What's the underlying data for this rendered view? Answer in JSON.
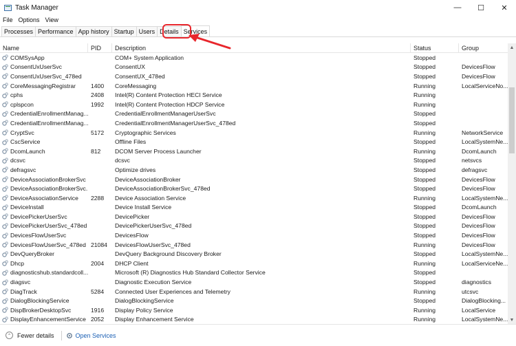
{
  "window": {
    "title": "Task Manager",
    "controls": [
      "—",
      "☐",
      "✕"
    ]
  },
  "menu": [
    "File",
    "Options",
    "View"
  ],
  "tabs": [
    {
      "label": "Processes",
      "active": false
    },
    {
      "label": "Performance",
      "active": false
    },
    {
      "label": "App history",
      "active": false
    },
    {
      "label": "Startup",
      "active": false
    },
    {
      "label": "Users",
      "active": false
    },
    {
      "label": "Details",
      "active": false
    },
    {
      "label": "Services",
      "active": true
    }
  ],
  "columns": [
    "Name",
    "PID",
    "Description",
    "Status",
    "Group"
  ],
  "services": [
    [
      "COMSysApp",
      "",
      "COM+ System Application",
      "Stopped",
      ""
    ],
    [
      "ConsentUxUserSvc",
      "",
      "ConsentUX",
      "Stopped",
      "DevicesFlow"
    ],
    [
      "ConsentUxUserSvc_478ed",
      "",
      "ConsentUX_478ed",
      "Stopped",
      "DevicesFlow"
    ],
    [
      "CoreMessagingRegistrar",
      "1400",
      "CoreMessaging",
      "Running",
      "LocalServiceNo..."
    ],
    [
      "cphs",
      "2408",
      "Intel(R) Content Protection HECI Service",
      "Running",
      ""
    ],
    [
      "cplspcon",
      "1992",
      "Intel(R) Content Protection HDCP Service",
      "Running",
      ""
    ],
    [
      "CredentialEnrollmentManag...",
      "",
      "CredentialEnrollmentManagerUserSvc",
      "Stopped",
      ""
    ],
    [
      "CredentialEnrollmentManag...",
      "",
      "CredentialEnrollmentManagerUserSvc_478ed",
      "Stopped",
      ""
    ],
    [
      "CryptSvc",
      "5172",
      "Cryptographic Services",
      "Running",
      "NetworkService"
    ],
    [
      "CscService",
      "",
      "Offline Files",
      "Stopped",
      "LocalSystemNe..."
    ],
    [
      "DcomLaunch",
      "812",
      "DCOM Server Process Launcher",
      "Running",
      "DcomLaunch"
    ],
    [
      "dcsvc",
      "",
      "dcsvc",
      "Stopped",
      "netsvcs"
    ],
    [
      "defragsvc",
      "",
      "Optimize drives",
      "Stopped",
      "defragsvc"
    ],
    [
      "DeviceAssociationBrokerSvc",
      "",
      "DeviceAssociationBroker",
      "Stopped",
      "DevicesFlow"
    ],
    [
      "DeviceAssociationBrokerSvc...",
      "",
      "DeviceAssociationBrokerSvc_478ed",
      "Stopped",
      "DevicesFlow"
    ],
    [
      "DeviceAssociationService",
      "2288",
      "Device Association Service",
      "Running",
      "LocalSystemNe..."
    ],
    [
      "DeviceInstall",
      "",
      "Device Install Service",
      "Stopped",
      "DcomLaunch"
    ],
    [
      "DevicePickerUserSvc",
      "",
      "DevicePicker",
      "Stopped",
      "DevicesFlow"
    ],
    [
      "DevicePickerUserSvc_478ed",
      "",
      "DevicePickerUserSvc_478ed",
      "Stopped",
      "DevicesFlow"
    ],
    [
      "DevicesFlowUserSvc",
      "",
      "DevicesFlow",
      "Stopped",
      "DevicesFlow"
    ],
    [
      "DevicesFlowUserSvc_478ed",
      "21084",
      "DevicesFlowUserSvc_478ed",
      "Running",
      "DevicesFlow"
    ],
    [
      "DevQueryBroker",
      "",
      "DevQuery Background Discovery Broker",
      "Stopped",
      "LocalSystemNe..."
    ],
    [
      "Dhcp",
      "2004",
      "DHCP Client",
      "Running",
      "LocalServiceNe..."
    ],
    [
      "diagnosticshub.standardcoll...",
      "",
      "Microsoft (R) Diagnostics Hub Standard Collector Service",
      "Stopped",
      ""
    ],
    [
      "diagsvc",
      "",
      "Diagnostic Execution Service",
      "Stopped",
      "diagnostics"
    ],
    [
      "DiagTrack",
      "5284",
      "Connected User Experiences and Telemetry",
      "Running",
      "utcsvc"
    ],
    [
      "DialogBlockingService",
      "",
      "DialogBlockingService",
      "Stopped",
      "DialogBlocking..."
    ],
    [
      "DispBrokerDesktopSvc",
      "1916",
      "Display Policy Service",
      "Running",
      "LocalService"
    ],
    [
      "DisplayEnhancementService",
      "2052",
      "Display Enhancement Service",
      "Running",
      "LocalSystemNe..."
    ]
  ],
  "footer": {
    "fewer_details": "Fewer details",
    "open_services": "Open Services"
  }
}
